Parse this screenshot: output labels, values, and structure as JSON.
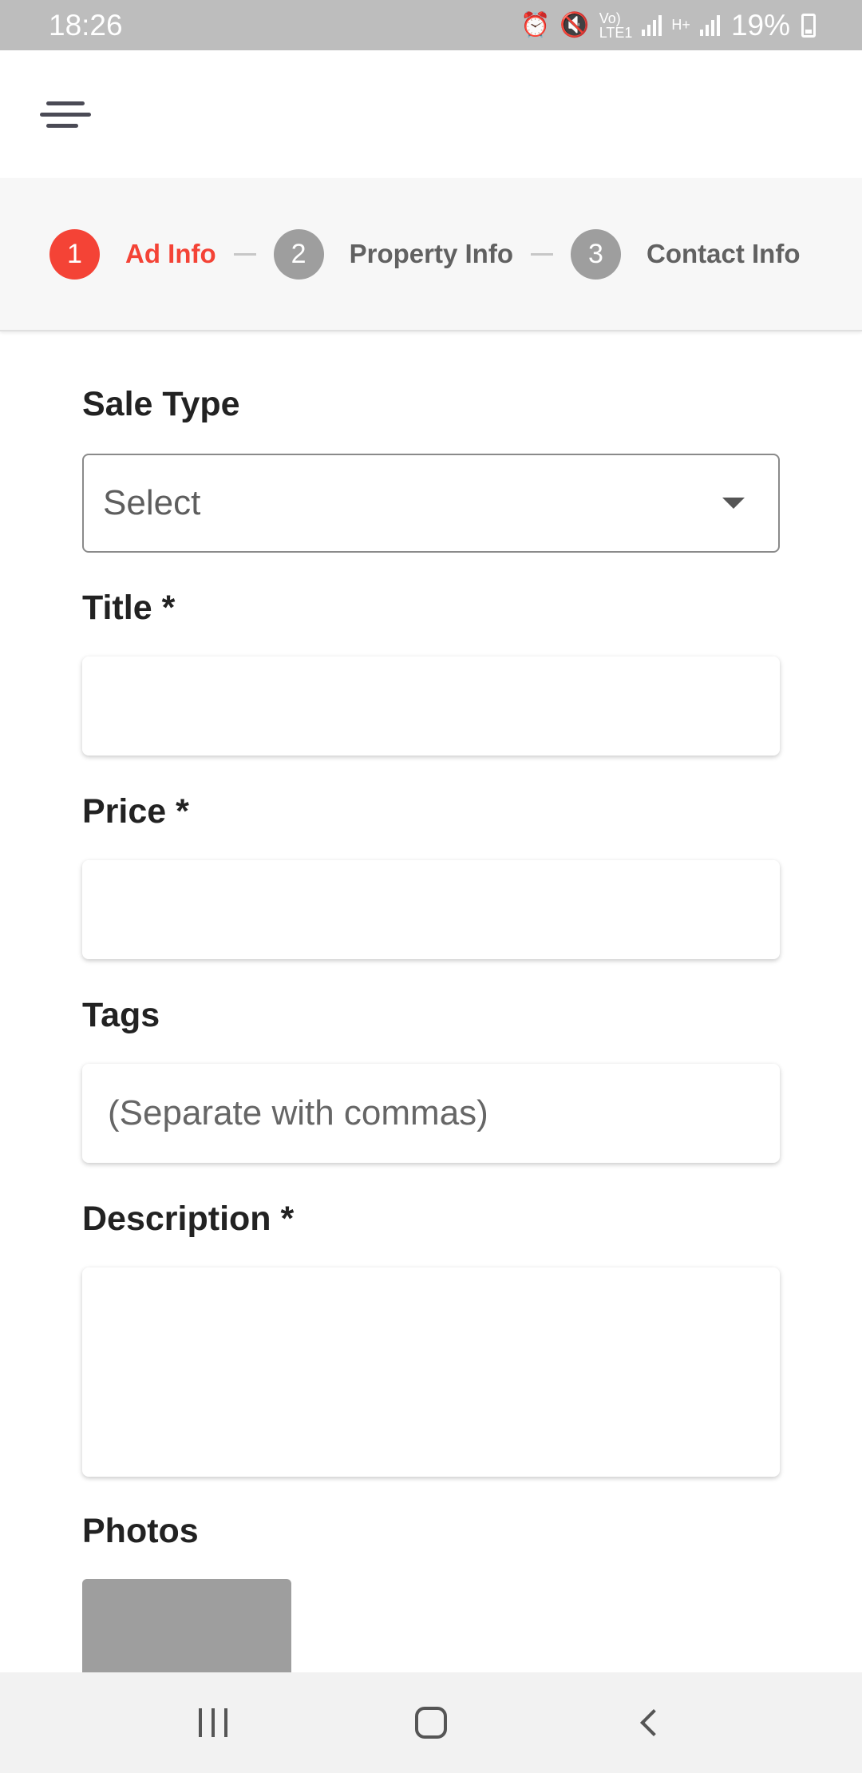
{
  "status_bar": {
    "time": "18:26",
    "battery": "19%",
    "network_label": "LTE1",
    "signal_type": "H+",
    "icons": [
      "alarm-icon",
      "mute-icon",
      "volte-icon",
      "signal-icon",
      "signal-icon",
      "battery-icon"
    ]
  },
  "app_bar": {
    "menu_icon": "hamburger-menu-icon"
  },
  "stepper": {
    "steps": [
      {
        "number": "1",
        "label": "Ad Info",
        "active": true
      },
      {
        "number": "2",
        "label": "Property Info",
        "active": false
      },
      {
        "number": "3",
        "label": "Contact Info",
        "active": false
      }
    ],
    "active_color": "#f44336",
    "inactive_color": "#9e9e9e"
  },
  "form": {
    "sale_type": {
      "label": "Sale Type",
      "value": "Select"
    },
    "title": {
      "label": "Title *",
      "value": "",
      "placeholder": ""
    },
    "price": {
      "label": "Price *",
      "value": "",
      "placeholder": ""
    },
    "tags": {
      "label": "Tags",
      "value": "",
      "placeholder": "(Separate with commas)"
    },
    "description": {
      "label": "Description *",
      "value": "",
      "placeholder": ""
    },
    "photos": {
      "label": "Photos"
    }
  },
  "nav_bar": {
    "icons": [
      "recents-icon",
      "home-icon",
      "back-icon"
    ]
  }
}
